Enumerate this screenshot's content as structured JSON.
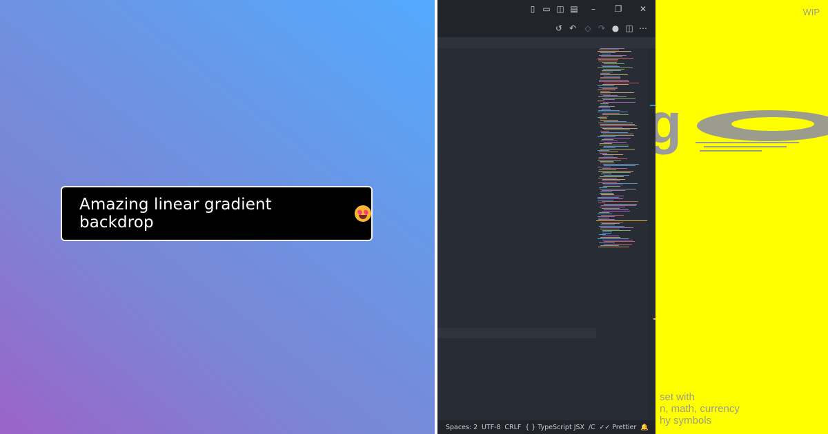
{
  "left": {
    "toast_text": "Amazing linear gradient backdrop",
    "emoji": "star-struck-face",
    "colors": {
      "gradient_start": "#9b63c8",
      "gradient_end": "#53aaff",
      "toast_bg": "#000000"
    }
  },
  "editor": {
    "titlebar_icons": [
      "toggle-primary-sidebar-icon",
      "toggle-panel-icon",
      "toggle-secondary-sidebar-icon",
      "customize-layout-icon",
      "minimize-icon",
      "restore-icon",
      "close-icon"
    ],
    "toolbar_icons": [
      "timeline-icon",
      "go-back-icon",
      "source-control-icon",
      "go-forward-icon",
      "github-icon",
      "split-editor-icon",
      "more-actions-icon"
    ],
    "status": {
      "spaces": "Spaces: 2",
      "encoding": "UTF-8",
      "eol": "CRLF",
      "language": "TypeScript JSX",
      "extra": "/C",
      "prettier": "Prettier"
    },
    "colors": {
      "bg": "#282c34",
      "chrome": "#21252b"
    }
  },
  "right": {
    "wip_label": "WIP",
    "glyph": "g",
    "desc_lines": [
      " set with",
      "n, math, currency",
      "hy symbols"
    ],
    "colors": {
      "bg": "#ffff00",
      "text": "#9c9c8e"
    }
  }
}
